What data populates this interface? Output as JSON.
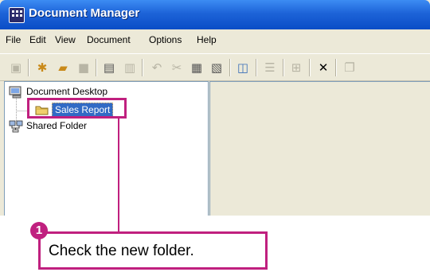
{
  "window": {
    "title": "Document Manager",
    "icon": "app-grid-icon"
  },
  "menu": {
    "items": [
      "File",
      "Edit",
      "View",
      "Document",
      "Options",
      "Help"
    ]
  },
  "toolbar": {
    "icons": [
      "document-icon",
      "new-doc-icon",
      "open-folder-icon",
      "save-icon",
      "scan-icon",
      "print-icon",
      "undo-icon",
      "cut-icon",
      "copy-icon",
      "paste-icon",
      "search-icon",
      "list-view-icon",
      "thumbnail-view-icon",
      "delete-icon",
      "copy-page-icon"
    ]
  },
  "tree": {
    "root": {
      "label": "Document Desktop",
      "icon": "desktop-icon"
    },
    "new_folder": {
      "label": "Sales Report",
      "icon": "folder-icon",
      "selected": true
    },
    "shared": {
      "label": "Shared Folder",
      "icon": "network-folder-icon"
    }
  },
  "callout": {
    "step": "1",
    "text": "Check the new folder."
  },
  "colors": {
    "accent": "#c0207f",
    "title_bar": "#0a4dc6",
    "selection": "#316ac5"
  }
}
